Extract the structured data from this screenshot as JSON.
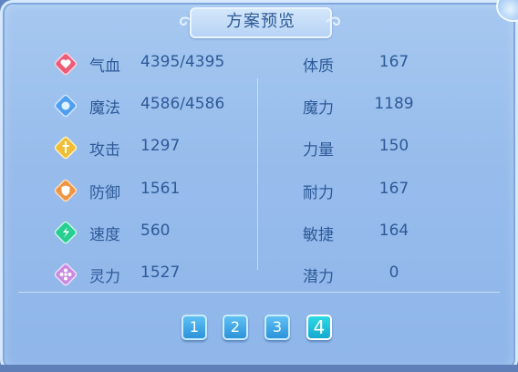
{
  "title": "方案预览",
  "attributes_left": [
    {
      "label": "气血",
      "value": "4395/4395",
      "icon": "heart-icon",
      "color": "#e8506a"
    },
    {
      "label": "魔法",
      "value": "4586/4586",
      "icon": "magic-icon",
      "color": "#3f95e8"
    },
    {
      "label": "攻击",
      "value": "1297",
      "icon": "sword-icon",
      "color": "#e8b52c"
    },
    {
      "label": "防御",
      "value": "1561",
      "icon": "shield-icon",
      "color": "#e88a3a"
    },
    {
      "label": "速度",
      "value": "560",
      "icon": "speed-icon",
      "color": "#23c98a"
    },
    {
      "label": "灵力",
      "value": "1527",
      "icon": "spirit-icon",
      "color": "#c27ad8"
    }
  ],
  "attributes_right": [
    {
      "label": "体质",
      "value": "167"
    },
    {
      "label": "魔力",
      "value": "1189"
    },
    {
      "label": "力量",
      "value": "150"
    },
    {
      "label": "耐力",
      "value": "167"
    },
    {
      "label": "敏捷",
      "value": "164"
    },
    {
      "label": "潜力",
      "value": "0"
    }
  ],
  "pages": [
    "1",
    "2",
    "3",
    "4"
  ],
  "active_page": "4"
}
